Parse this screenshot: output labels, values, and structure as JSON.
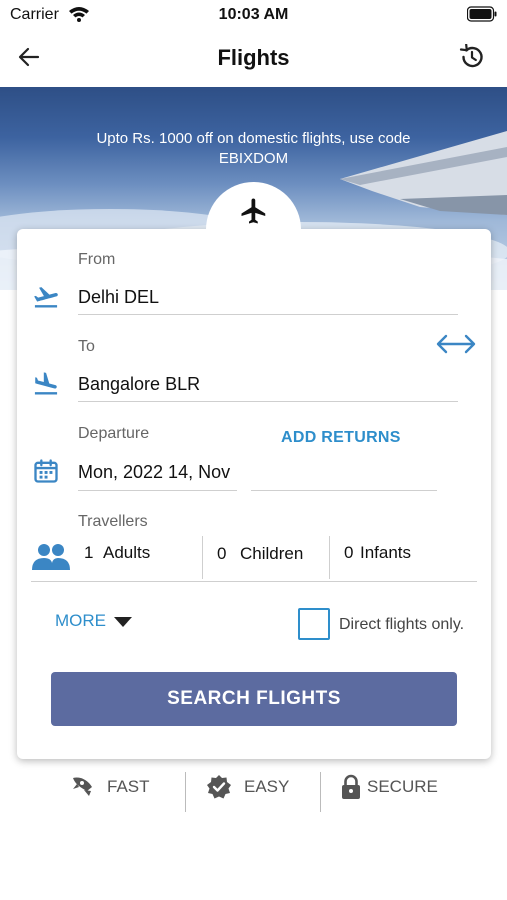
{
  "status_bar": {
    "carrier": "Carrier",
    "time": "10:03 AM"
  },
  "nav": {
    "title": "Flights"
  },
  "banner": {
    "promo_text": "Upto Rs. 1000 off on domestic flights, use code EBIXDOM"
  },
  "form": {
    "from": {
      "label": "From",
      "value": "Delhi DEL"
    },
    "to": {
      "label": "To",
      "value": "Bangalore BLR"
    },
    "departure": {
      "label": "Departure",
      "value": "Mon, 2022 14, Nov",
      "add_returns": "ADD RETURNS"
    },
    "travellers": {
      "label": "Travellers",
      "adults_count": "1",
      "adults_label": "Adults",
      "children_count": "0",
      "children_label": "Children",
      "infants_count": "0",
      "infants_label": "Infants"
    },
    "more_label": "MORE",
    "direct_only_label": "Direct flights only."
  },
  "search_button": "SEARCH FLIGHTS",
  "features": [
    {
      "label": "FAST",
      "icon": "rocket-icon"
    },
    {
      "label": "EASY",
      "icon": "verified-badge-icon"
    },
    {
      "label": "SECURE",
      "icon": "lock-icon"
    }
  ],
  "colors": {
    "accent": "#2e8ecb",
    "button": "#5c6ba0",
    "icon_blue": "#3b86c4"
  }
}
